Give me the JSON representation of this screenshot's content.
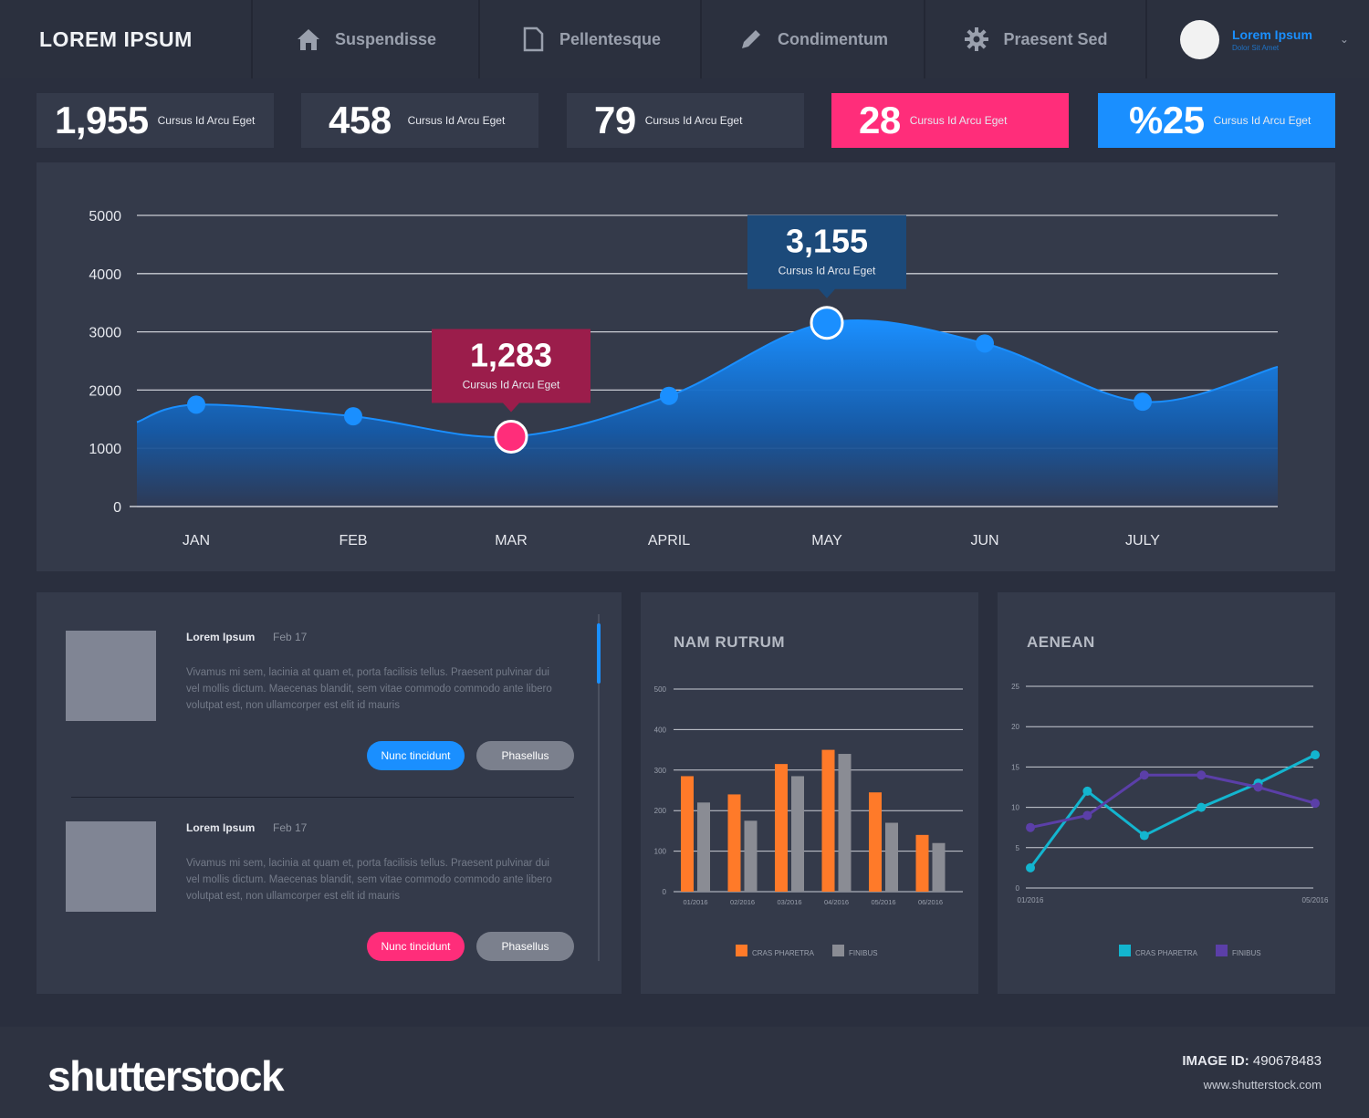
{
  "nav": {
    "brand": "LOREM IPSUM",
    "items": [
      {
        "label": "Suspendisse",
        "icon": "home-icon"
      },
      {
        "label": "Pellentesque",
        "icon": "document-icon"
      },
      {
        "label": "Condimentum",
        "icon": "pencil-icon"
      },
      {
        "label": "Praesent Sed",
        "icon": "gear-icon"
      }
    ],
    "user": {
      "name": "Lorem Ipsum",
      "subtitle": "Dolor Sit Amet"
    }
  },
  "stats": [
    {
      "value": "1,955",
      "label": "Cursus Id Arcu Eget"
    },
    {
      "value": "458",
      "label": "Cursus Id Arcu Eget"
    },
    {
      "value": "79",
      "label": "Cursus Id Arcu Eget"
    },
    {
      "value": "28",
      "label": "Cursus Id Arcu Eget"
    },
    {
      "value": "%25",
      "label": "Cursus Id Arcu Eget"
    }
  ],
  "colors": {
    "blue": "#1a8fff",
    "pink": "#ff2d7a",
    "orange": "#ff7a29",
    "grey": "#8a8c94",
    "teal": "#13b5cf",
    "purple": "#5b3fa8",
    "tooltip_red": "#9b1d4b",
    "tooltip_blue": "#1c4a7a"
  },
  "posts": [
    {
      "title": "Lorem Ipsum",
      "date": "Feb 17",
      "body": "Vivamus mi sem, lacinia at quam et, porta facilisis tellus. Praesent pulvinar dui vel mollis dictum. Maecenas blandit, sem vitae commodo commodo  ante libero volutpat est, non ullamcorper est elit id mauris",
      "primary": "Nunc tincidunt",
      "secondary": "Phasellus"
    },
    {
      "title": "Lorem Ipsum",
      "date": "Feb 17",
      "body": "Vivamus mi sem, lacinia at quam et, porta facilisis tellus. Praesent pulvinar dui vel mollis dictum. Maecenas blandit, sem vitae commodo commodo  ante libero volutpat est, non ullamcorper est elit id mauris",
      "primary": "Nunc tincidunt",
      "secondary": "Phasellus"
    }
  ],
  "footer": {
    "logo": "shutterstock",
    "id_label": "IMAGE ID:",
    "id_value": "490678483",
    "url": "www.shutterstock.com"
  },
  "chart_data": [
    {
      "type": "area",
      "categories": [
        "JAN",
        "FEB",
        "MAR",
        "APRIL",
        "MAY",
        "JUN",
        "JULY"
      ],
      "values": [
        1750,
        1550,
        1200,
        1900,
        3155,
        2800,
        1800
      ],
      "ylim": [
        0,
        5000
      ],
      "yticks": [
        0,
        1000,
        2000,
        3000,
        4000,
        5000
      ],
      "grid": true,
      "annotations": [
        {
          "category": "MAR",
          "value": "1,283",
          "label": "Cursus Id Arcu Eget"
        },
        {
          "category": "MAY",
          "value": "3,155",
          "label": "Cursus Id Arcu Eget"
        }
      ]
    },
    {
      "type": "bar",
      "title": "NAM RUTRUM",
      "categories": [
        "01/2016",
        "02/2016",
        "03/2016",
        "04/2016",
        "05/2016",
        "06/2016"
      ],
      "series": [
        {
          "name": "CRAS PHARETRA",
          "values": [
            285,
            240,
            315,
            350,
            245,
            140
          ]
        },
        {
          "name": "FINIBUS",
          "values": [
            220,
            175,
            285,
            340,
            170,
            120
          ]
        }
      ],
      "ylim": [
        0,
        500
      ],
      "yticks": [
        0,
        100,
        200,
        300,
        400,
        500
      ],
      "legend": "bottom",
      "grid": true
    },
    {
      "type": "line",
      "title": "AENEAN",
      "x": [
        "01/2016",
        "",
        "",
        "",
        "",
        "05/2016"
      ],
      "series": [
        {
          "name": "CRAS PHARETRA",
          "values": [
            2.5,
            12,
            6.5,
            10,
            13,
            16.5
          ]
        },
        {
          "name": "FINIBUS",
          "values": [
            7.5,
            9,
            14,
            14,
            12.5,
            10.5
          ]
        }
      ],
      "ylim": [
        0,
        25
      ],
      "yticks": [
        0,
        5,
        10,
        15,
        20,
        25
      ],
      "legend": "bottom",
      "grid": true
    }
  ]
}
